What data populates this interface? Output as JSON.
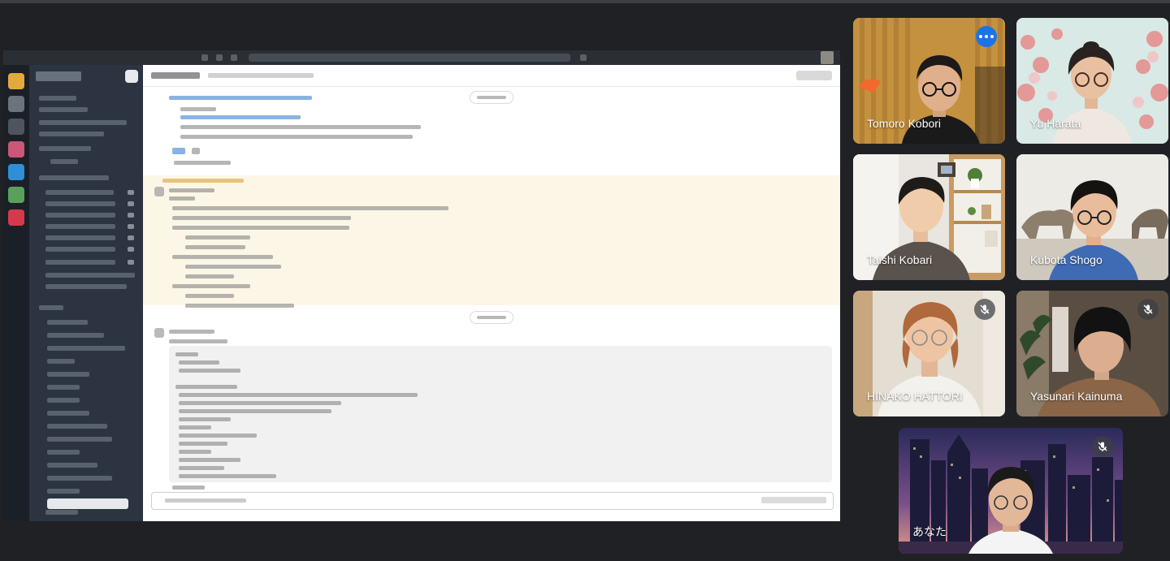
{
  "meeting": {
    "accent_color": "#8ab4f8",
    "more_options_color": "#1a73e8",
    "muted_icon": "mic-off-icon",
    "more_icon": "more-horiz-icon"
  },
  "shared_screen": {
    "app": "team chat (blurred)"
  },
  "participants": [
    {
      "name": "Tomoro Kobori",
      "speaking": true,
      "muted": false,
      "options": true
    },
    {
      "name": "Yu Harata",
      "speaking": false,
      "muted": false,
      "options": false
    },
    {
      "name": "Taishi Kobari",
      "speaking": false,
      "muted": false,
      "options": false
    },
    {
      "name": "Kubota Shogo",
      "speaking": false,
      "muted": false,
      "options": false
    },
    {
      "name": "HINAKO HATTORI",
      "speaking": false,
      "muted": true,
      "options": false
    },
    {
      "name": "Yasunari Kainuma",
      "speaking": false,
      "muted": true,
      "options": false
    },
    {
      "name": "あなた",
      "speaking": false,
      "muted": true,
      "options": false
    }
  ]
}
